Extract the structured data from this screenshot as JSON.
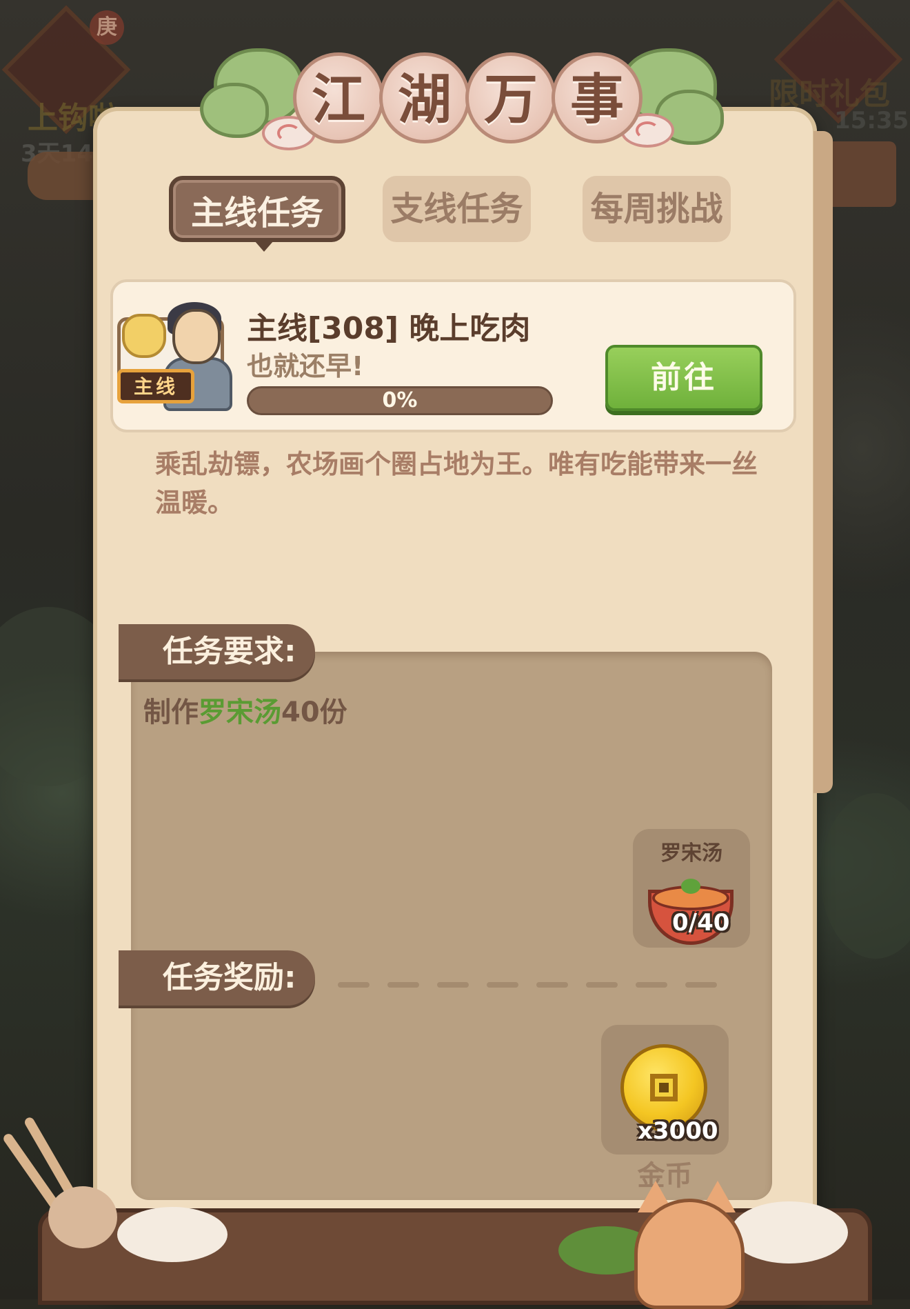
{
  "corner_left": {
    "tag": "庚",
    "title": "上钩啦",
    "timer": "3天14"
  },
  "corner_right": {
    "title": "限时礼包",
    "timer": "15:35"
  },
  "title": {
    "chars": [
      "江",
      "湖",
      "万",
      "事"
    ]
  },
  "tabs": [
    {
      "label": "主线任务",
      "active": true
    },
    {
      "label": "支线任务",
      "active": false
    },
    {
      "label": "每周挑战",
      "active": false
    }
  ],
  "quest": {
    "badge": "主线",
    "title": "主线[308] 晚上吃肉",
    "subtitle": "也就还早!",
    "progress_text": "0%",
    "progress_value": 0,
    "go_button": "前往"
  },
  "description": "乘乱劫镖，农场画个圈占地为王。唯有吃能带来一丝温暖。",
  "requirements": {
    "label": "任务要求:",
    "text_prefix": "制作",
    "text_item": "罗宋汤",
    "text_suffix": "40份",
    "item": {
      "name": "罗宋汤",
      "count": "0/40",
      "icon": "soup-bowl-icon"
    }
  },
  "rewards": {
    "label": "任务奖励:",
    "items": [
      {
        "name": "金币",
        "count": "x3000",
        "icon": "coin-icon"
      }
    ]
  },
  "colors": {
    "highlight_green": "#5a9b33",
    "go_button": "#7ac14a",
    "panel": "#f0ddc0",
    "tab_active": "#8a6a58"
  }
}
